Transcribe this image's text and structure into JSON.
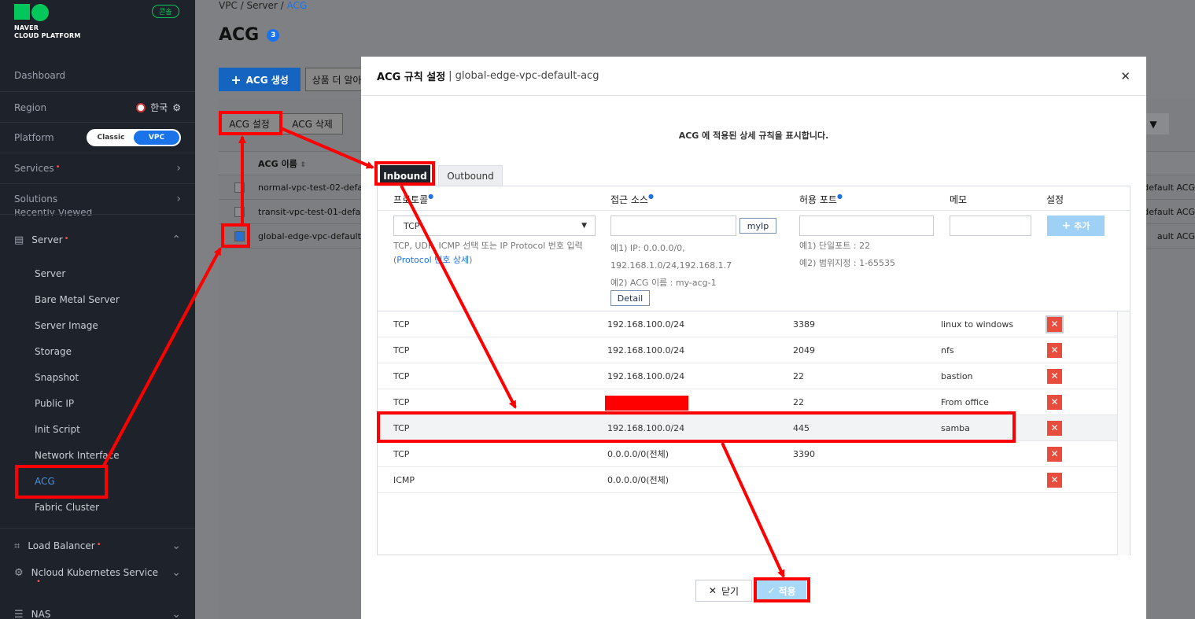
{
  "brand": {
    "line1": "NAVER",
    "line2": "CLOUD PLATFORM",
    "console_badge": "콘솔"
  },
  "sidebar": {
    "dashboard": "Dashboard",
    "region_label": "Region",
    "region_value": "한국",
    "platform_label": "Platform",
    "platform_options": [
      "Classic",
      "VPC"
    ],
    "platform_selected": "VPC",
    "services": "Services",
    "solutions": "Solutions",
    "recently_viewed": "Recently Viewed",
    "server_group": "Server",
    "server_items": [
      "Server",
      "Bare Metal Server",
      "Server Image",
      "Storage",
      "Snapshot",
      "Public IP",
      "Init Script",
      "Network Interface",
      "ACG",
      "Fabric Cluster"
    ],
    "active_item": "ACG",
    "load_balancer": "Load Balancer",
    "kubernetes": "Ncloud Kubernetes Service",
    "nas": "NAS"
  },
  "page": {
    "breadcrumb": [
      "VPC",
      "Server",
      "ACG"
    ],
    "title": "ACG",
    "count": "3",
    "create_button": "ACG 생성",
    "more_button": "상품 더 알아",
    "settings_button": "ACG 설정",
    "delete_button": "ACG 삭제",
    "column_name": "ACG 이름",
    "rows": [
      {
        "name": "normal-vpc-test-02-defau",
        "right": "default ACG",
        "checked": false
      },
      {
        "name": "transit-vpc-test-01-defau",
        "right": "default ACG",
        "checked": false
      },
      {
        "name": "global-edge-vpc-default-a",
        "right": "ault ACG",
        "checked": true
      }
    ]
  },
  "modal": {
    "title": "ACG 규칙 설정",
    "subtitle": "| global-edge-vpc-default-acg",
    "description": "ACG 에 적용된 상세 규칙을 표시합니다.",
    "tabs": [
      "Inbound",
      "Outbound"
    ],
    "active_tab": "Inbound",
    "headers": {
      "protocol": "프로토콜",
      "source": "접근 소스",
      "port": "허용 포트",
      "memo": "메모",
      "setting": "설정"
    },
    "form": {
      "protocol_value": "TCP",
      "protocol_hint": "TCP, UDP, ICMP 선택 또는 IP Protocol 번호 입력",
      "protocol_link": "Protocol 번호 상세",
      "source_value": "",
      "myip_button": "myIp",
      "source_hint1": "예1) IP: 0.0.0.0/0,",
      "source_hint2": "192.168.1.0/24,192.168.1.7",
      "source_hint3": "예2) ACG 이름 : my-acg-1",
      "detail_button": "Detail",
      "port_value": "",
      "port_hint1": "예1) 단일포트 : 22",
      "port_hint2": "예2) 범위지정 : 1-65535",
      "memo_value": "",
      "add_button": "추가"
    },
    "rules": [
      {
        "protocol": "TCP",
        "source": "192.168.100.0/24",
        "port": "3389",
        "memo": "linux to windows"
      },
      {
        "protocol": "TCP",
        "source": "192.168.100.0/24",
        "port": "2049",
        "memo": "nfs"
      },
      {
        "protocol": "TCP",
        "source": "192.168.100.0/24",
        "port": "22",
        "memo": "bastion"
      },
      {
        "protocol": "TCP",
        "source": "",
        "port": "22",
        "memo": "From office",
        "redacted": true
      },
      {
        "protocol": "TCP",
        "source": "192.168.100.0/24",
        "port": "445",
        "memo": "samba"
      },
      {
        "protocol": "TCP",
        "source": "0.0.0.0/0(전체)",
        "port": "3390",
        "memo": ""
      },
      {
        "protocol": "ICMP",
        "source": "0.0.0.0/0(전체)",
        "port": "",
        "memo": ""
      }
    ],
    "close_button": "닫기",
    "apply_button": "적용"
  },
  "colors": {
    "accent": "#1a73e8",
    "annotation": "#ff0000",
    "delete": "#e74c3c",
    "sidebar_bg": "#1e222a"
  },
  "icons": {
    "server": "server-icon",
    "load_balancer": "network-icon",
    "kubernetes": "gear-icon",
    "nas": "storage-icon",
    "settings": "gear-icon"
  }
}
